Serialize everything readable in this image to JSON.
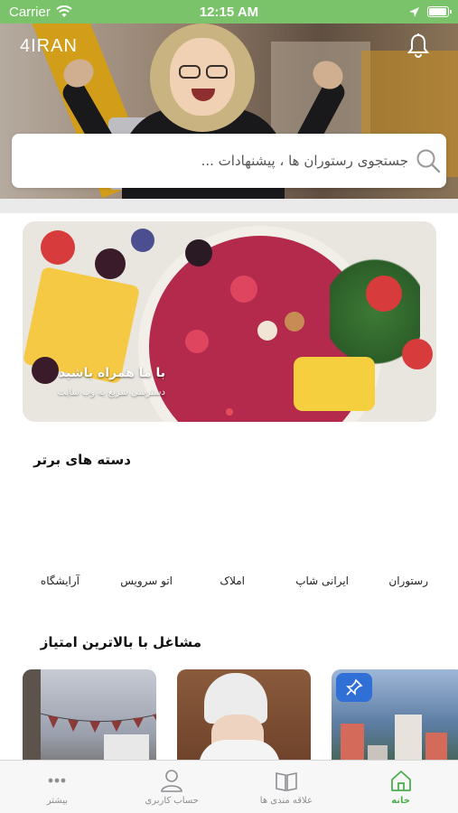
{
  "status_bar": {
    "carrier": "Carrier",
    "time": "12:15 AM"
  },
  "header": {
    "logo": "4IRAN",
    "bell_icon": "bell-icon"
  },
  "search": {
    "placeholder": "جستجوی رستوران ها ، پیشنهادات ..."
  },
  "banner": {
    "title": "با ما همراه باشید",
    "subtitle": "دسترسی سریع به وب سایت",
    "active_dot_color": "#e64b5b"
  },
  "top_categories": {
    "title": "دسته های برتر",
    "items": [
      "رستوران",
      "ایرانی شاپ",
      "املاک",
      "اتو سرویس",
      "آرایشگاه"
    ]
  },
  "top_rated": {
    "title": "مشاغل با بالاترین امتیاز"
  },
  "tab_bar": {
    "items": [
      {
        "label": "خانه",
        "icon": "home-icon",
        "active": true
      },
      {
        "label": "علاقه مندی ها",
        "icon": "book-icon",
        "active": false
      },
      {
        "label": "حساب کاربری",
        "icon": "user-icon",
        "active": false
      },
      {
        "label": "بیشتر",
        "icon": "more-icon",
        "active": false
      }
    ]
  },
  "colors": {
    "status_bar": "#7ac36a",
    "tab_active": "#4cae4c",
    "tab_inactive": "#8e8e93",
    "pin_badge": "#2f6fd6"
  }
}
